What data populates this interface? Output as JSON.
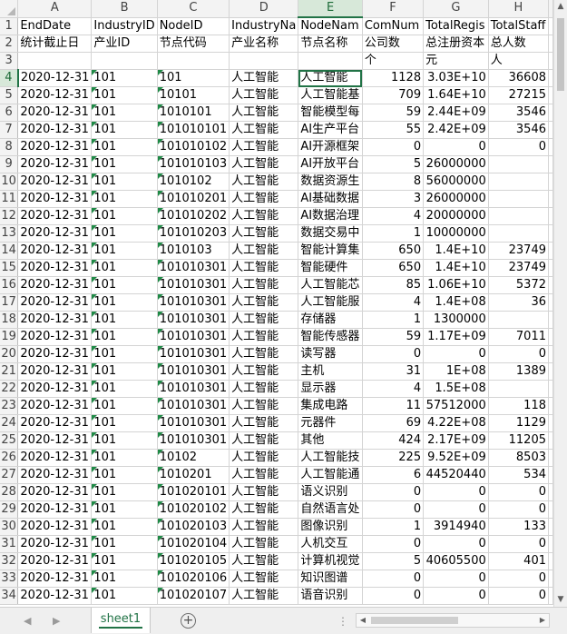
{
  "sheet": {
    "columns": [
      "A",
      "B",
      "C",
      "D",
      "E",
      "F",
      "G",
      "H"
    ],
    "selected_column": "E",
    "selected_row": "4",
    "rows": [
      {
        "num": "1",
        "cells": [
          "EndDate",
          "IndustryID",
          "NodeID",
          "IndustryNa",
          "NodeNam",
          "ComNum",
          "TotalRegis",
          "TotalStaff"
        ]
      },
      {
        "num": "2",
        "cells": [
          "统计截止日",
          "产业ID",
          "节点代码",
          "产业名称",
          "节点名称",
          "公司数",
          "总注册资本",
          "总人数"
        ]
      },
      {
        "num": "3",
        "cells": [
          "",
          "",
          "",
          "",
          "",
          "个",
          "元",
          "人"
        ]
      },
      {
        "num": "4",
        "cells": [
          "2020-12-31",
          "101",
          "101",
          "人工智能",
          "人工智能",
          "1128",
          "3.03E+10",
          "36608"
        ]
      },
      {
        "num": "5",
        "cells": [
          "2020-12-31",
          "101",
          "10101",
          "人工智能",
          "人工智能基",
          "709",
          "1.64E+10",
          "27215"
        ]
      },
      {
        "num": "6",
        "cells": [
          "2020-12-31",
          "101",
          "1010101",
          "人工智能",
          "智能模型每",
          "59",
          "2.44E+09",
          "3546"
        ]
      },
      {
        "num": "7",
        "cells": [
          "2020-12-31",
          "101",
          "101010101",
          "人工智能",
          "AI生产平台",
          "55",
          "2.42E+09",
          "3546"
        ]
      },
      {
        "num": "8",
        "cells": [
          "2020-12-31",
          "101",
          "101010102",
          "人工智能",
          "AI开源框架",
          "0",
          "0",
          "0"
        ]
      },
      {
        "num": "9",
        "cells": [
          "2020-12-31",
          "101",
          "101010103",
          "人工智能",
          "AI开放平台",
          "5",
          "26000000",
          ""
        ]
      },
      {
        "num": "10",
        "cells": [
          "2020-12-31",
          "101",
          "1010102",
          "人工智能",
          "数据资源生",
          "8",
          "56000000",
          ""
        ]
      },
      {
        "num": "11",
        "cells": [
          "2020-12-31",
          "101",
          "101010201",
          "人工智能",
          "AI基础数据",
          "3",
          "26000000",
          ""
        ]
      },
      {
        "num": "12",
        "cells": [
          "2020-12-31",
          "101",
          "101010202",
          "人工智能",
          "AI数据治理",
          "4",
          "20000000",
          ""
        ]
      },
      {
        "num": "13",
        "cells": [
          "2020-12-31",
          "101",
          "101010203",
          "人工智能",
          "数据交易中",
          "1",
          "10000000",
          ""
        ]
      },
      {
        "num": "14",
        "cells": [
          "2020-12-31",
          "101",
          "1010103",
          "人工智能",
          "智能计算集",
          "650",
          "1.4E+10",
          "23749"
        ]
      },
      {
        "num": "15",
        "cells": [
          "2020-12-31",
          "101",
          "101010301",
          "人工智能",
          "智能硬件",
          "650",
          "1.4E+10",
          "23749"
        ]
      },
      {
        "num": "16",
        "cells": [
          "2020-12-31",
          "101",
          "101010301",
          "人工智能",
          "人工智能芯",
          "85",
          "1.06E+10",
          "5372"
        ]
      },
      {
        "num": "17",
        "cells": [
          "2020-12-31",
          "101",
          "101010301",
          "人工智能",
          "人工智能服",
          "4",
          "1.4E+08",
          "36"
        ]
      },
      {
        "num": "18",
        "cells": [
          "2020-12-31",
          "101",
          "101010301",
          "人工智能",
          "存储器",
          "1",
          "1300000",
          ""
        ]
      },
      {
        "num": "19",
        "cells": [
          "2020-12-31",
          "101",
          "101010301",
          "人工智能",
          "智能传感器",
          "59",
          "1.17E+09",
          "7011"
        ]
      },
      {
        "num": "20",
        "cells": [
          "2020-12-31",
          "101",
          "101010301",
          "人工智能",
          "读写器",
          "0",
          "0",
          "0"
        ]
      },
      {
        "num": "21",
        "cells": [
          "2020-12-31",
          "101",
          "101010301",
          "人工智能",
          "主机",
          "31",
          "1E+08",
          "1389"
        ]
      },
      {
        "num": "22",
        "cells": [
          "2020-12-31",
          "101",
          "101010301",
          "人工智能",
          "显示器",
          "4",
          "1.5E+08",
          ""
        ]
      },
      {
        "num": "23",
        "cells": [
          "2020-12-31",
          "101",
          "101010301",
          "人工智能",
          "集成电路",
          "11",
          "57512000",
          "118"
        ]
      },
      {
        "num": "24",
        "cells": [
          "2020-12-31",
          "101",
          "101010301",
          "人工智能",
          "元器件",
          "69",
          "4.22E+08",
          "1129"
        ]
      },
      {
        "num": "25",
        "cells": [
          "2020-12-31",
          "101",
          "101010301",
          "人工智能",
          "其他",
          "424",
          "2.17E+09",
          "11205"
        ]
      },
      {
        "num": "26",
        "cells": [
          "2020-12-31",
          "101",
          "10102",
          "人工智能",
          "人工智能技",
          "225",
          "9.52E+09",
          "8503"
        ]
      },
      {
        "num": "27",
        "cells": [
          "2020-12-31",
          "101",
          "1010201",
          "人工智能",
          "人工智能通",
          "6",
          "44520440",
          "534"
        ]
      },
      {
        "num": "28",
        "cells": [
          "2020-12-31",
          "101",
          "101020101",
          "人工智能",
          "语义识别",
          "0",
          "0",
          "0"
        ]
      },
      {
        "num": "29",
        "cells": [
          "2020-12-31",
          "101",
          "101020102",
          "人工智能",
          "自然语言处",
          "0",
          "0",
          "0"
        ]
      },
      {
        "num": "30",
        "cells": [
          "2020-12-31",
          "101",
          "101020103",
          "人工智能",
          "图像识别",
          "1",
          "3914940",
          "133"
        ]
      },
      {
        "num": "31",
        "cells": [
          "2020-12-31",
          "101",
          "101020104",
          "人工智能",
          "人机交互",
          "0",
          "0",
          "0"
        ]
      },
      {
        "num": "32",
        "cells": [
          "2020-12-31",
          "101",
          "101020105",
          "人工智能",
          "计算机视觉",
          "5",
          "40605500",
          "401"
        ]
      },
      {
        "num": "33",
        "cells": [
          "2020-12-31",
          "101",
          "101020106",
          "人工智能",
          "知识图谱",
          "0",
          "0",
          "0"
        ]
      },
      {
        "num": "34",
        "cells": [
          "2020-12-31",
          "101",
          "101020107",
          "人工智能",
          "语音识别",
          "0",
          "0",
          "0"
        ]
      }
    ]
  },
  "tabs": {
    "active": "sheet1",
    "nav_left": "◀",
    "nav_right": "▶",
    "add_symbol": "+",
    "more_symbol": "⋮"
  },
  "scroll": {
    "up": "▲",
    "down": "▼",
    "left": "◀",
    "right": "▶"
  },
  "colors": {
    "accent": "#217346",
    "selected_header_bg": "#d7e8d9",
    "error_triangle": "#1f8a46"
  }
}
